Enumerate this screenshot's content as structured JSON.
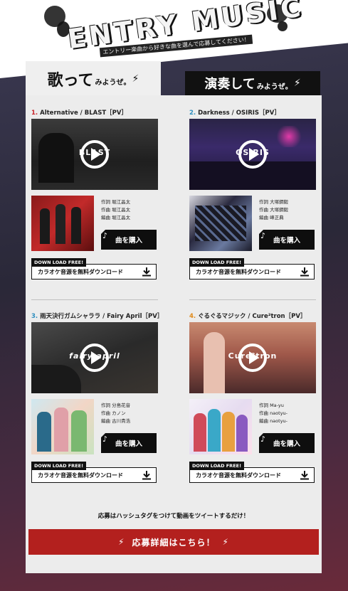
{
  "header": {
    "title": "ENTRY MUSIC",
    "subtitle": "エントリー楽曲から好きな曲を選んで応募してください！"
  },
  "tabs": [
    {
      "big": "歌って",
      "small": "みようぜ。",
      "bolt": "⚡"
    },
    {
      "big": "演奏して",
      "small": "みようぜ。",
      "bolt": "⚡"
    }
  ],
  "cards": [
    {
      "num": "1.",
      "title": "Alternative / BLAST［PV］",
      "logo": "BLAST",
      "credits": [
        "作詞 堀江晶太",
        "作曲 堀江晶太",
        "編曲 堀江晶太"
      ],
      "buy_label": "曲を購入",
      "note": "♪",
      "dl_tag": "DOWN LOAD FREE!",
      "dl_label": "カラオケ音源を無料ダウンロード"
    },
    {
      "num": "2.",
      "title": "Darkness / OSIRIS［PV］",
      "logo": "OSIRIS",
      "credits": [
        "作詞 大塚鋼毅",
        "作曲 大塚鋼毅",
        "編曲 峰正典"
      ],
      "buy_label": "曲を購入",
      "note": "♪",
      "dl_tag": "DOWN LOAD FREE!",
      "dl_label": "カラオケ音源を無料ダウンロード"
    },
    {
      "num": "3.",
      "title": "雨天決行ガムシャララ / Fairy April［PV］",
      "logo": "fairy april",
      "credits": [
        "作詞 分島花音",
        "作曲 カノン",
        "編曲 古川貴浩"
      ],
      "buy_label": "曲を購入",
      "note": "♪",
      "dl_tag": "DOWN LOAD FREE!",
      "dl_label": "カラオケ音源を無料ダウンロード"
    },
    {
      "num": "4.",
      "title": "ぐるぐるマジック / Cure²tron［PV］",
      "logo": "Cure²tron",
      "credits": [
        "作詞 Ma-yu",
        "作曲 naotyu-",
        "編曲 naotyu-"
      ],
      "buy_label": "曲を購入",
      "note": "♪",
      "dl_tag": "DOWN LOAD FREE!",
      "dl_label": "カラオケ音源を無料ダウンロード"
    }
  ],
  "footer": {
    "tweet_text": "応募はハッシュタグをつけて動画をツイートするだけ！",
    "cta_label": "応募詳細はこちら！",
    "cta_bolt": "⚡"
  },
  "colors": {
    "accent_red": "#b3201e",
    "num_red": "#c8242a",
    "num_blue": "#2f8fbf",
    "num_orange": "#e08a1a"
  },
  "icons": [
    "bolt-icon",
    "play-icon",
    "music-note-icon",
    "download-icon"
  ]
}
